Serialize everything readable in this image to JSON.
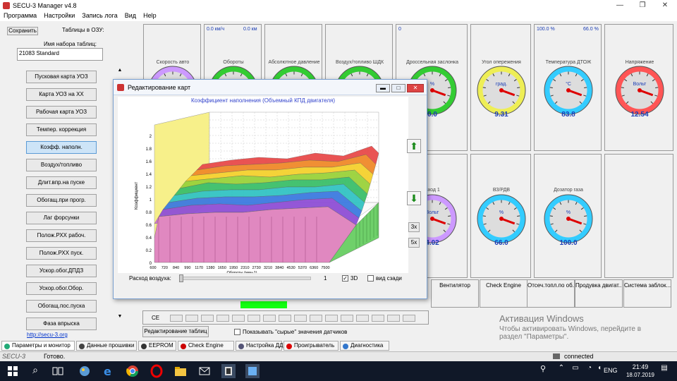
{
  "window": {
    "title": "SECU-3 Manager v4.8"
  },
  "menu": [
    "Программа",
    "Настройки",
    "Запись лога",
    "Вид",
    "Help"
  ],
  "left": {
    "save_label": "Сохранить",
    "tables_label": "Таблицы в ОЗУ:",
    "set_name_label": "Имя набора таблиц:",
    "set_name_value": "21083 Standard",
    "buttons": [
      "Пусковая карта УОЗ",
      "Карта УОЗ на ХХ",
      "Рабочая карта УОЗ",
      "Темпер. коррекция",
      "Коэфф. наполн.",
      "Воздух/топливо",
      "Длит.впр.на пуске",
      "Обогащ.при прогр.",
      "Лаг форсунки",
      "Полож.РХХ рабоч.",
      "Полож.РХХ пуск.",
      "Ускор.обог.ДПДЗ",
      "Ускор.обог.Обор.",
      "Обогащ.пос.пуска",
      "Фаза впрыска"
    ],
    "selected_index": 4,
    "link": "http://secu-3.org"
  },
  "gauges_top": [
    {
      "top_left": "",
      "top_right": "",
      "title": "Скорость авто",
      "unit": "",
      "value": "",
      "color": "#c9f"
    },
    {
      "top_left": "0.0 км/ч",
      "top_right": "0.0 км",
      "title": "Обороты",
      "unit": "",
      "value": "",
      "color": "#3c3"
    },
    {
      "top_left": "",
      "top_right": "",
      "title": "Абсолютное давление",
      "unit": "",
      "value": "",
      "color": "#3c3"
    },
    {
      "top_left": "",
      "top_right": "",
      "title": "Воздух/топливо ШДК",
      "unit": "",
      "value": "",
      "color": "#3c3"
    },
    {
      "top_left": "0",
      "top_right": "",
      "title": "Дроссельная заслонка",
      "unit": "%",
      "value": "0.0",
      "color": "#3c3"
    },
    {
      "top_left": "",
      "top_right": "",
      "title": "Угол опережения",
      "unit": "град.",
      "value": "9.31",
      "color": "#ee5"
    },
    {
      "top_left": "100.0 %",
      "top_right": "66.0 %",
      "title": "Температура ДТОЖ",
      "unit": "°C",
      "value": "83.8",
      "color": "#3cf"
    },
    {
      "top_left": "",
      "top_right": "",
      "title": "Напряжение",
      "unit": "Вольт",
      "value": "12.54",
      "color": "#f55"
    }
  ],
  "gauges_bottom": [
    {
      "title": "Вход 1",
      "unit": "Вольт",
      "value": "4.02",
      "color": "#c9f"
    },
    {
      "title": "ВЗ/РДВ",
      "unit": "%",
      "value": "66.0",
      "color": "#3cf"
    },
    {
      "title": "Дозатор газа",
      "unit": "%",
      "value": "100.0",
      "color": "#3cf"
    }
  ],
  "status_buttons": [
    "Вентилятор",
    "Check Engine",
    "Отсеч.топл.по об...",
    "Продувка двигат...",
    "Система заблок..."
  ],
  "dialog": {
    "title": "Редактирование карт",
    "plot_title": "Коэффициент наполнения (Объемный КПД двигателя)",
    "zlabel": "Коэффициент",
    "xlabel": "Обороты (мин-1)",
    "z_ticks": [
      "0",
      "0.2",
      "0.4",
      "0.6",
      "0.8",
      "1",
      "1.2",
      "1.4",
      "1.6",
      "1.8",
      "2"
    ],
    "x_ticks": [
      "600",
      "720",
      "840",
      "990",
      "1170",
      "1380",
      "1650",
      "1950",
      "2310",
      "2730",
      "3210",
      "3840",
      "4530",
      "5370",
      "6360",
      "7500"
    ],
    "air_label": "Расход воздуха:",
    "air_value": "1",
    "check_3d": "3D",
    "check_back": "вид сзади",
    "x3": "3x",
    "x5": "5x"
  },
  "bottom_bar": {
    "ce": "CE",
    "edit_tables": "Редактирование таблиц",
    "raw_values": "Показывать \"сырые\" значения датчиков"
  },
  "tabs": [
    "Параметры и монитор",
    "Данные прошивки",
    "EEPROM",
    "Check Engine",
    "Настройка ДД",
    "Проигрыватель",
    "Диагностика"
  ],
  "status": {
    "left": "SECU-3",
    "ready": "Готово.",
    "connection": "connected"
  },
  "watermark": {
    "line1": "Активация Windows",
    "line2": "Чтобы активировать Windows, перейдите в",
    "line3": "раздел \"Параметры\"."
  },
  "tray": {
    "lang": "ENG",
    "time": "21:49",
    "date": "18.07.2019"
  }
}
